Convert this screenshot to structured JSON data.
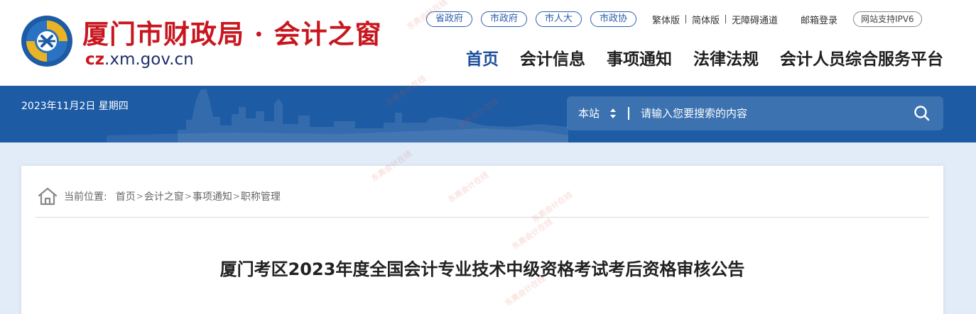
{
  "header": {
    "site_title": "厦门市财政局 · 会计之窗",
    "domain_prefix": "cz",
    "domain_suffix": ".xm.gov.cn",
    "gov_links": [
      "省政府",
      "市政府",
      "市人大",
      "市政协"
    ],
    "util_links": [
      "繁体版",
      "简体版",
      "无障碍通道"
    ],
    "mail_login": "邮箱登录",
    "ipv6_badge": "网站支持IPV6",
    "nav": [
      "首页",
      "会计信息",
      "事项通知",
      "法律法规",
      "会计人员综合服务平台"
    ],
    "active_nav": "首页"
  },
  "banner": {
    "date": "2023年11月2日 星期四",
    "search": {
      "scope": "本站",
      "placeholder": "请输入您要搜索的内容"
    }
  },
  "content": {
    "breadcrumb": {
      "label": "当前位置:",
      "items": [
        "首页",
        "会计之窗",
        "事项通知",
        "职称管理"
      ]
    },
    "title": "厦门考区2023年度全国会计专业技术中级资格考试考后资格审核公告"
  },
  "watermark_text": "东奥会计在线",
  "colors": {
    "brand_red": "#c8161e",
    "brand_blue": "#1d5ba4",
    "nav_active": "#1b4f9c",
    "content_bg": "#e2ecf8"
  }
}
